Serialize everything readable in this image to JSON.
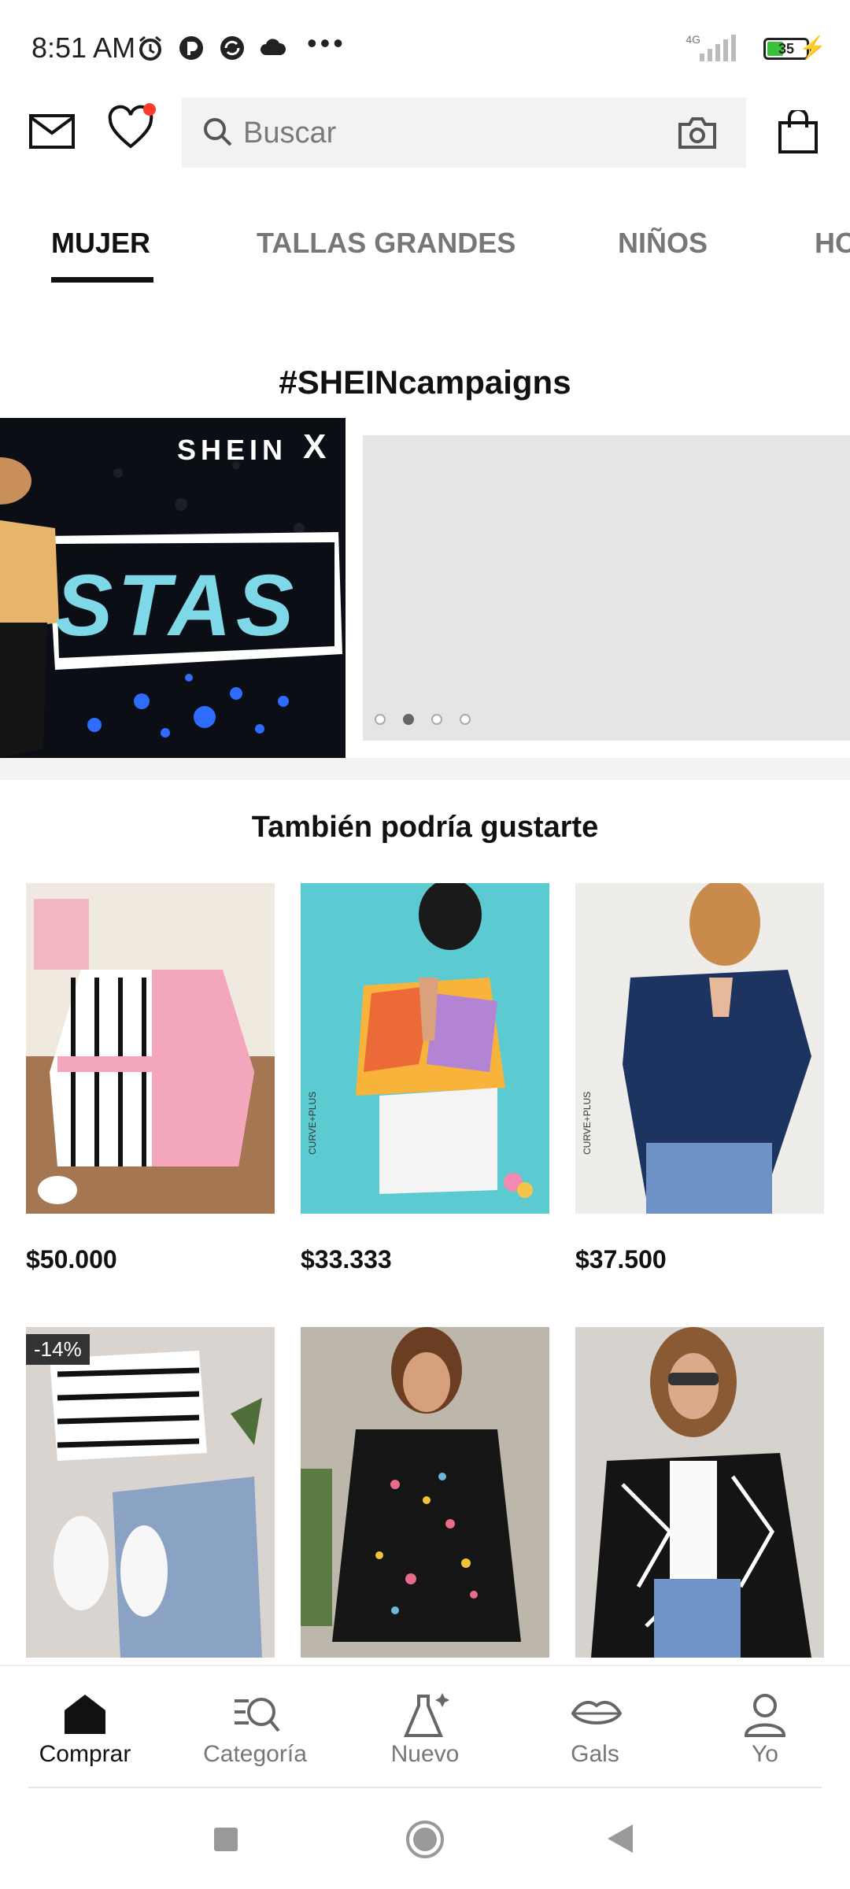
{
  "status_bar": {
    "time": "8:51 AM",
    "network": "4G",
    "battery": "35",
    "more": "•••",
    "icons": [
      "alarm-icon",
      "app-icon",
      "sync-icon",
      "cloud-icon"
    ]
  },
  "header": {
    "search_placeholder": "Buscar",
    "icons": [
      "mail-icon",
      "heart-icon",
      "search-icon",
      "camera-icon",
      "bag-icon"
    ]
  },
  "tabs": [
    {
      "label": "MUJER",
      "active": true
    },
    {
      "label": "TALLAS GRANDES",
      "active": false
    },
    {
      "label": "NIÑOS",
      "active": false
    },
    {
      "label": "HO",
      "active": false
    }
  ],
  "campaigns": {
    "title": "#SHEINcampaigns",
    "banner_logo": "SHEIN",
    "banner_text": "STAS",
    "carousel_dots": 4,
    "active_dot": 2
  },
  "recommendations": {
    "title": "También podría gustarte",
    "products": [
      {
        "price": "$50.000",
        "badge": ""
      },
      {
        "price": "$33.333",
        "badge": "",
        "brand": "CURVE+PLUS"
      },
      {
        "price": "$37.500",
        "badge": "",
        "brand": "CURVE+PLUS"
      },
      {
        "price": "",
        "badge": "-14%"
      },
      {
        "price": "",
        "badge": ""
      },
      {
        "price": "",
        "badge": ""
      }
    ]
  },
  "bottom_nav": [
    {
      "label": "Comprar",
      "active": true,
      "icon": "home-icon"
    },
    {
      "label": "Categoría",
      "active": false,
      "icon": "category-search-icon"
    },
    {
      "label": "Nuevo",
      "active": false,
      "icon": "new-dress-icon"
    },
    {
      "label": "Gals",
      "active": false,
      "icon": "lips-icon"
    },
    {
      "label": "Yo",
      "active": false,
      "icon": "person-icon"
    }
  ],
  "colors": {
    "accent": "#111111",
    "notification": "#ff3b30",
    "battery": "#39c13a"
  }
}
